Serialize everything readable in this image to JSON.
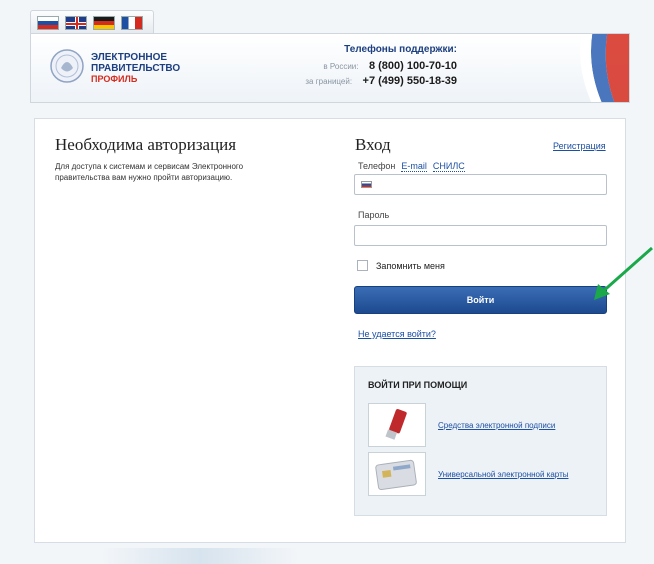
{
  "languages": [
    {
      "name": "russian",
      "icon": "flag-russia-icon"
    },
    {
      "name": "english",
      "icon": "flag-uk-icon"
    },
    {
      "name": "german",
      "icon": "flag-germany-icon"
    },
    {
      "name": "french",
      "icon": "flag-france-icon"
    }
  ],
  "header": {
    "logo_line1": "ЭЛЕКТРОННОЕ",
    "logo_line2": "ПРАВИТЕЛЬСТВО",
    "logo_line3": "ПРОФИЛЬ",
    "support_title": "Телефоны поддержки:",
    "phone_ru_label": "в России:",
    "phone_ru": "8 (800) 100-70-10",
    "phone_abroad_label": "за границей:",
    "phone_abroad": "+7 (499) 550-18-39"
  },
  "left": {
    "title": "Необходима авторизация",
    "description": "Для доступа к системам и сервисам Электронного правительства вам нужно пройти авторизацию."
  },
  "login": {
    "title": "Вход",
    "register_link": "Регистрация",
    "tab_phone": "Телефон",
    "tab_email": "E-mail",
    "tab_snils": "СНИЛС",
    "phone_value": "",
    "password_label": "Пароль",
    "password_value": "",
    "remember_label": "Запомнить меня",
    "submit_label": "Войти",
    "cant_login": "Не удается войти?"
  },
  "alt_login": {
    "title": "ВОЙТИ ПРИ ПОМОЩИ",
    "item1": "Средства электронной подписи",
    "item2": "Универсальной электронной карты"
  },
  "colors": {
    "accent": "#1d4fa3",
    "button": "#1d4a8f",
    "arrow": "#1aa84a"
  }
}
